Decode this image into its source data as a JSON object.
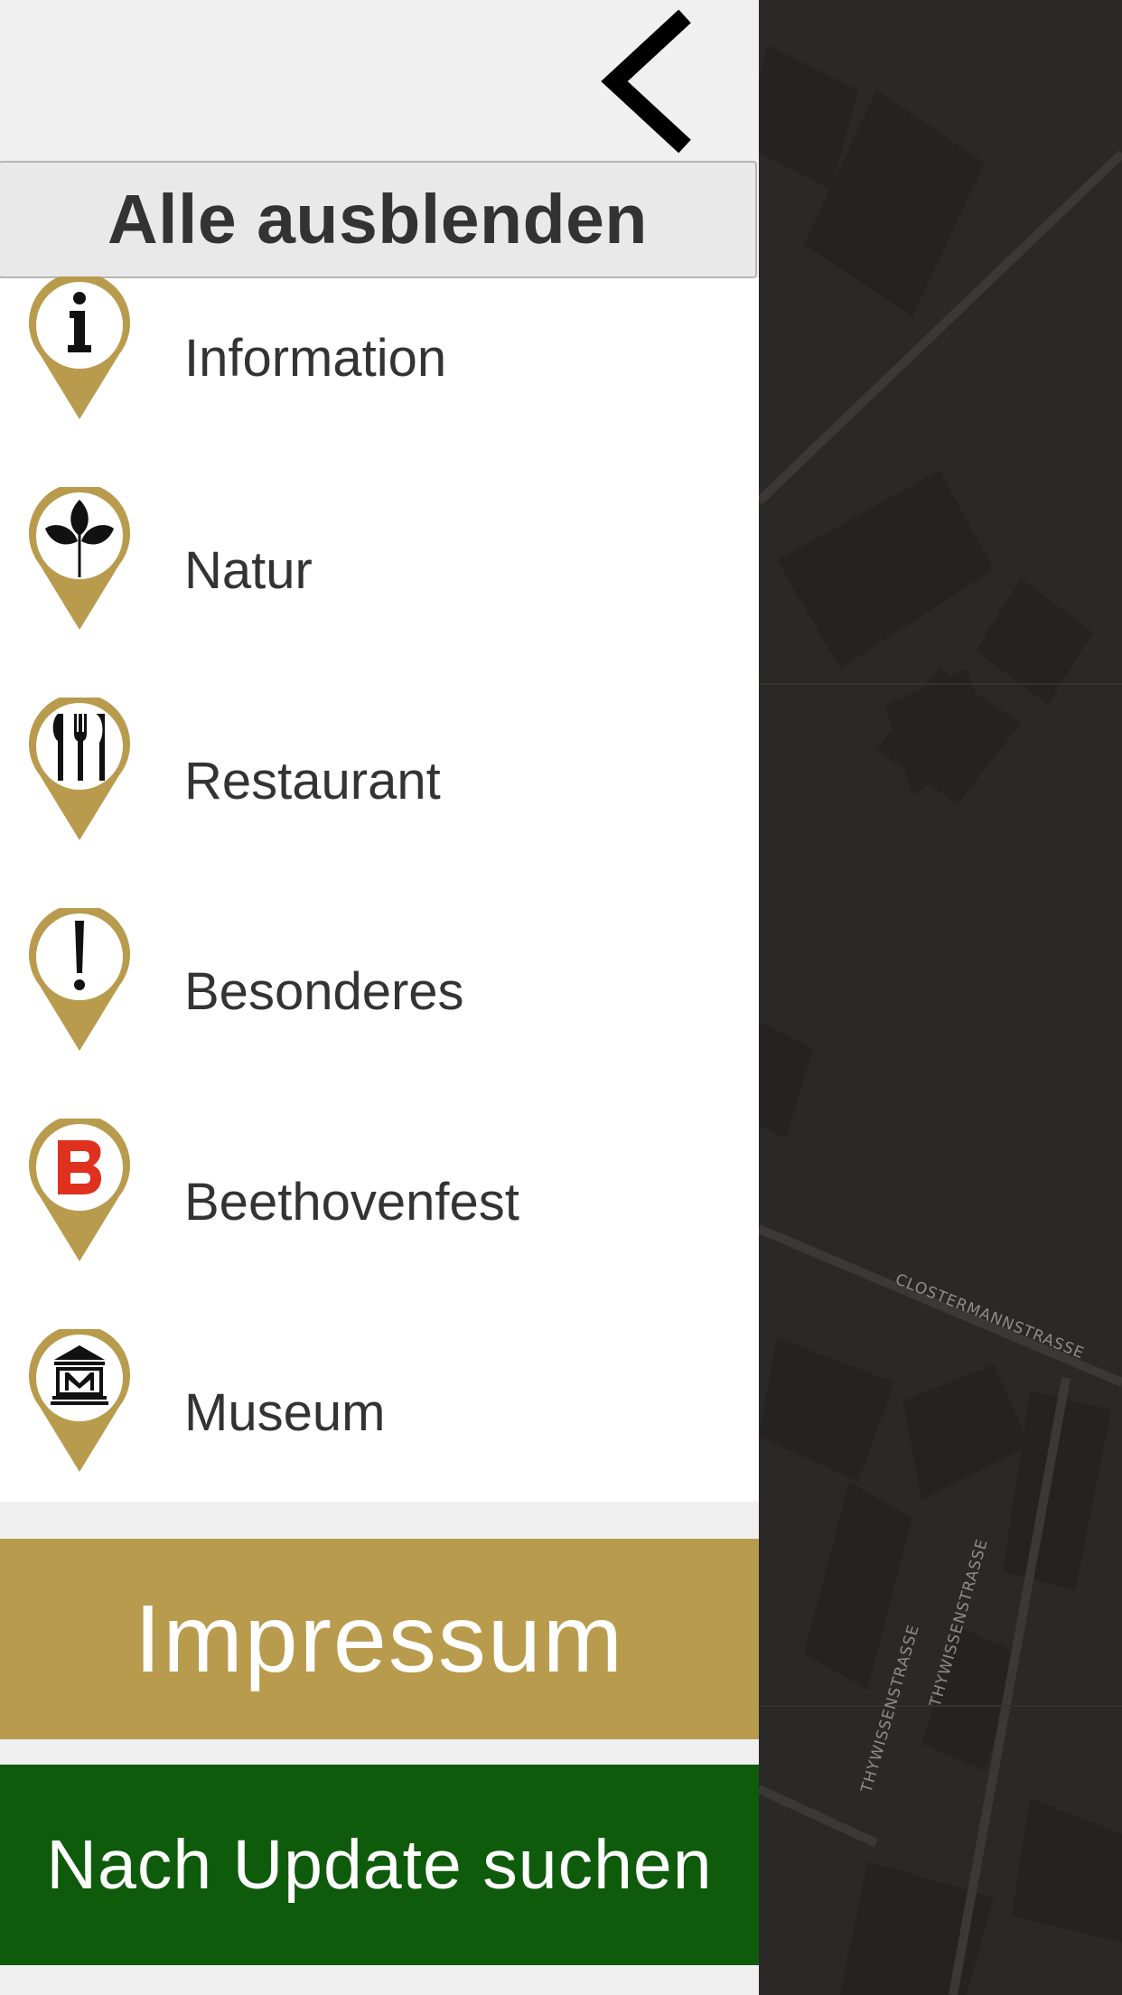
{
  "drawer": {
    "back_icon": "chevron-left-icon",
    "hide_all_label": "Alle ausblenden",
    "categories": [
      {
        "label": "Information",
        "icon": "info-pin-icon"
      },
      {
        "label": "Natur",
        "icon": "leaf-pin-icon"
      },
      {
        "label": "Restaurant",
        "icon": "cutlery-pin-icon"
      },
      {
        "label": "Besonderes",
        "icon": "exclamation-pin-icon"
      },
      {
        "label": "Beethovenfest",
        "icon": "beethovenfest-pin-icon"
      },
      {
        "label": "Museum",
        "icon": "museum-pin-icon"
      }
    ],
    "impressum_label": "Impressum",
    "update_label": "Nach Update suchen"
  },
  "map": {
    "streets": [
      "CLOSTERMANNSTRASSE",
      "THYWISSENSTRASSE",
      "THYWISSENSTRASSE"
    ]
  },
  "colors": {
    "gold": "#b89b4d",
    "green": "#0e5b0c",
    "map_bg": "#2a2928",
    "beethovenfest_red": "#e0301e"
  }
}
